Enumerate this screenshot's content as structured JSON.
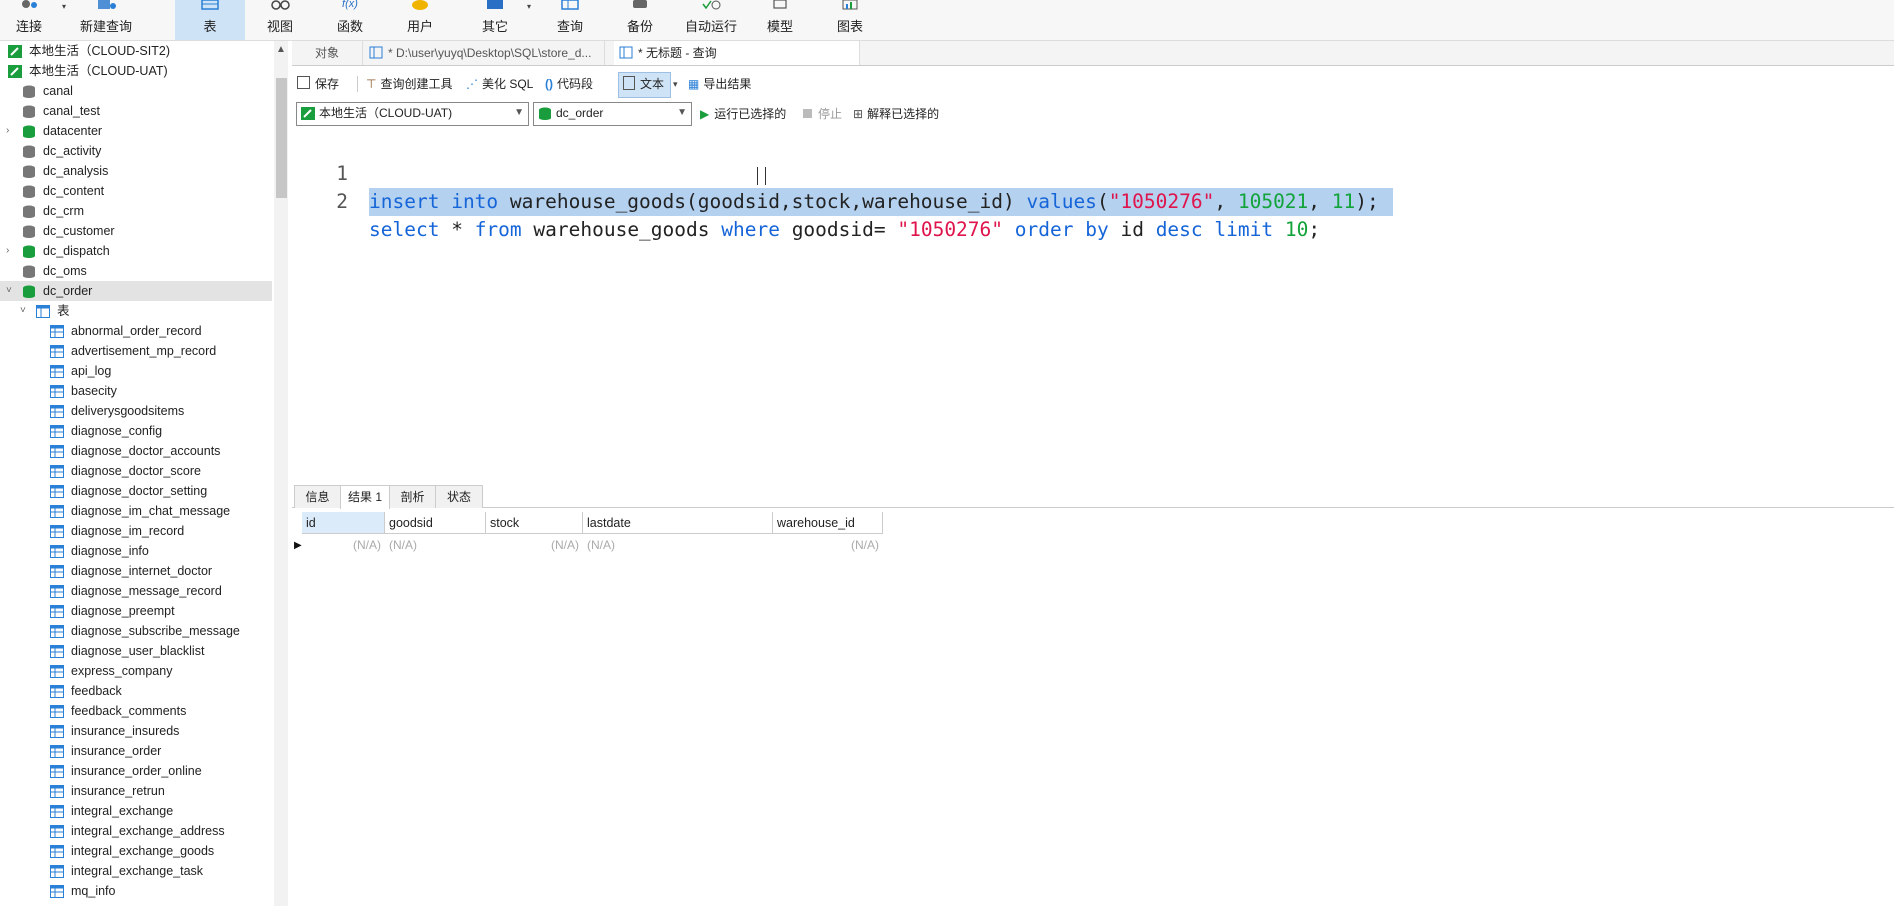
{
  "toolbar": {
    "items": [
      {
        "label": "连接",
        "icon": "connect-icon"
      },
      {
        "label": "新建查询",
        "icon": "new-query-icon"
      },
      {
        "label": "表",
        "icon": "table-icon"
      },
      {
        "label": "视图",
        "icon": "view-icon"
      },
      {
        "label": "函数",
        "icon": "function-icon"
      },
      {
        "label": "用户",
        "icon": "user-icon"
      },
      {
        "label": "其它",
        "icon": "other-icon"
      },
      {
        "label": "查询",
        "icon": "query-icon"
      },
      {
        "label": "备份",
        "icon": "backup-icon"
      },
      {
        "label": "自动运行",
        "icon": "autorun-icon"
      },
      {
        "label": "模型",
        "icon": "model-icon"
      },
      {
        "label": "图表",
        "icon": "chart-icon"
      }
    ]
  },
  "sidebar": {
    "connections": [
      {
        "label": "本地生活（CLOUD-SIT2)"
      },
      {
        "label": "本地生活（CLOUD-UAT)"
      }
    ],
    "databases": [
      "canal",
      "canal_test",
      "datacenter",
      "dc_activity",
      "dc_analysis",
      "dc_content",
      "dc_crm",
      "dc_customer",
      "dc_dispatch",
      "dc_oms",
      "dc_order"
    ],
    "tables_folder": "表",
    "tables": [
      "abnormal_order_record",
      "advertisement_mp_record",
      "api_log",
      "basecity",
      "deliverysgoodsitems",
      "diagnose_config",
      "diagnose_doctor_accounts",
      "diagnose_doctor_score",
      "diagnose_doctor_setting",
      "diagnose_im_chat_message",
      "diagnose_im_record",
      "diagnose_info",
      "diagnose_internet_doctor",
      "diagnose_message_record",
      "diagnose_preempt",
      "diagnose_subscribe_message",
      "diagnose_user_blacklist",
      "express_company",
      "feedback",
      "feedback_comments",
      "insurance_insureds",
      "insurance_order",
      "insurance_order_online",
      "insurance_retrun",
      "integral_exchange",
      "integral_exchange_address",
      "integral_exchange_goods",
      "integral_exchange_task",
      "mq_info"
    ]
  },
  "tabs": {
    "objects": "对象",
    "file": "* D:\\user\\yuyq\\Desktop\\SQL\\store_d...",
    "query": "* 无标题 - 查询"
  },
  "editor_toolbar": {
    "save": "保存",
    "query_builder": "查询创建工具",
    "beautify": "美化 SQL",
    "snippet": "代码段",
    "text": "文本",
    "export": "导出结果",
    "connection": "本地生活（CLOUD-UAT)",
    "database": "dc_order",
    "run_selected": "运行已选择的",
    "stop": "停止",
    "explain": "解释已选择的"
  },
  "code": {
    "line1_no": "1",
    "line2_no": "2",
    "l1": [
      "insert",
      " ",
      "into",
      " warehouse_goods(goodsid,stock,warehouse_id) ",
      "values",
      "(",
      "\"1050276\"",
      ", ",
      "105021",
      ", ",
      "11",
      ");"
    ],
    "l2": [
      "select",
      " * ",
      "from",
      " warehouse_goods ",
      "where",
      " goodsid= ",
      "\"1050276\"",
      " ",
      "order",
      " ",
      "by",
      " id ",
      "desc",
      " ",
      "limit",
      " ",
      "10",
      ";"
    ]
  },
  "result_tabs": [
    "信息",
    "结果 1",
    "剖析",
    "状态"
  ],
  "grid": {
    "columns": [
      "id",
      "goodsid",
      "stock",
      "lastdate",
      "warehouse_id"
    ],
    "row": [
      "(N/A)",
      "(N/A)",
      "(N/A)",
      "(N/A)",
      "(N/A)"
    ]
  },
  "colors": {
    "keyword": "#1565d8",
    "string": "#e0144c",
    "number": "#12a33a",
    "selection": "#b5d1f0"
  }
}
